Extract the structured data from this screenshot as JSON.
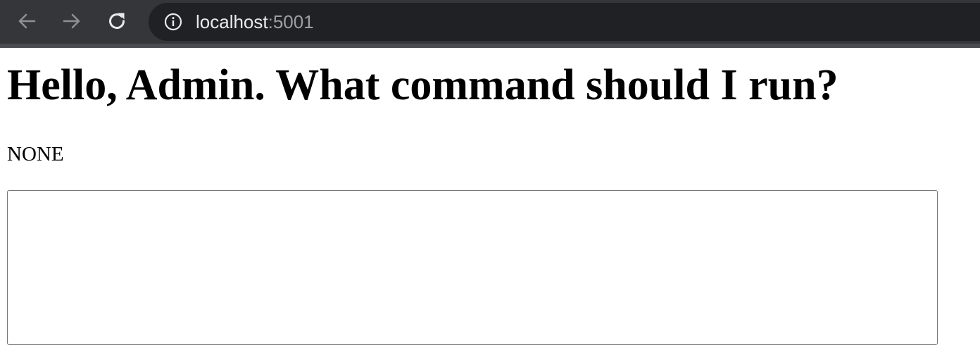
{
  "browser": {
    "url_host": "localhost",
    "url_port": ":5001",
    "icons": {
      "back": "arrow-left-icon",
      "forward": "arrow-right-icon",
      "reload": "reload-icon",
      "site_info": "info-icon"
    },
    "colors": {
      "toolbar_bg": "#35363a",
      "address_bg": "#202124",
      "host_text": "#e8eaed",
      "port_text": "#9aa0a6",
      "disabled_icon": "#8e8f93",
      "active_icon": "#e8eaed"
    }
  },
  "page": {
    "title": "Hello, Admin. What command should I run?",
    "status": "NONE",
    "command_input": {
      "value": "",
      "placeholder": ""
    }
  }
}
